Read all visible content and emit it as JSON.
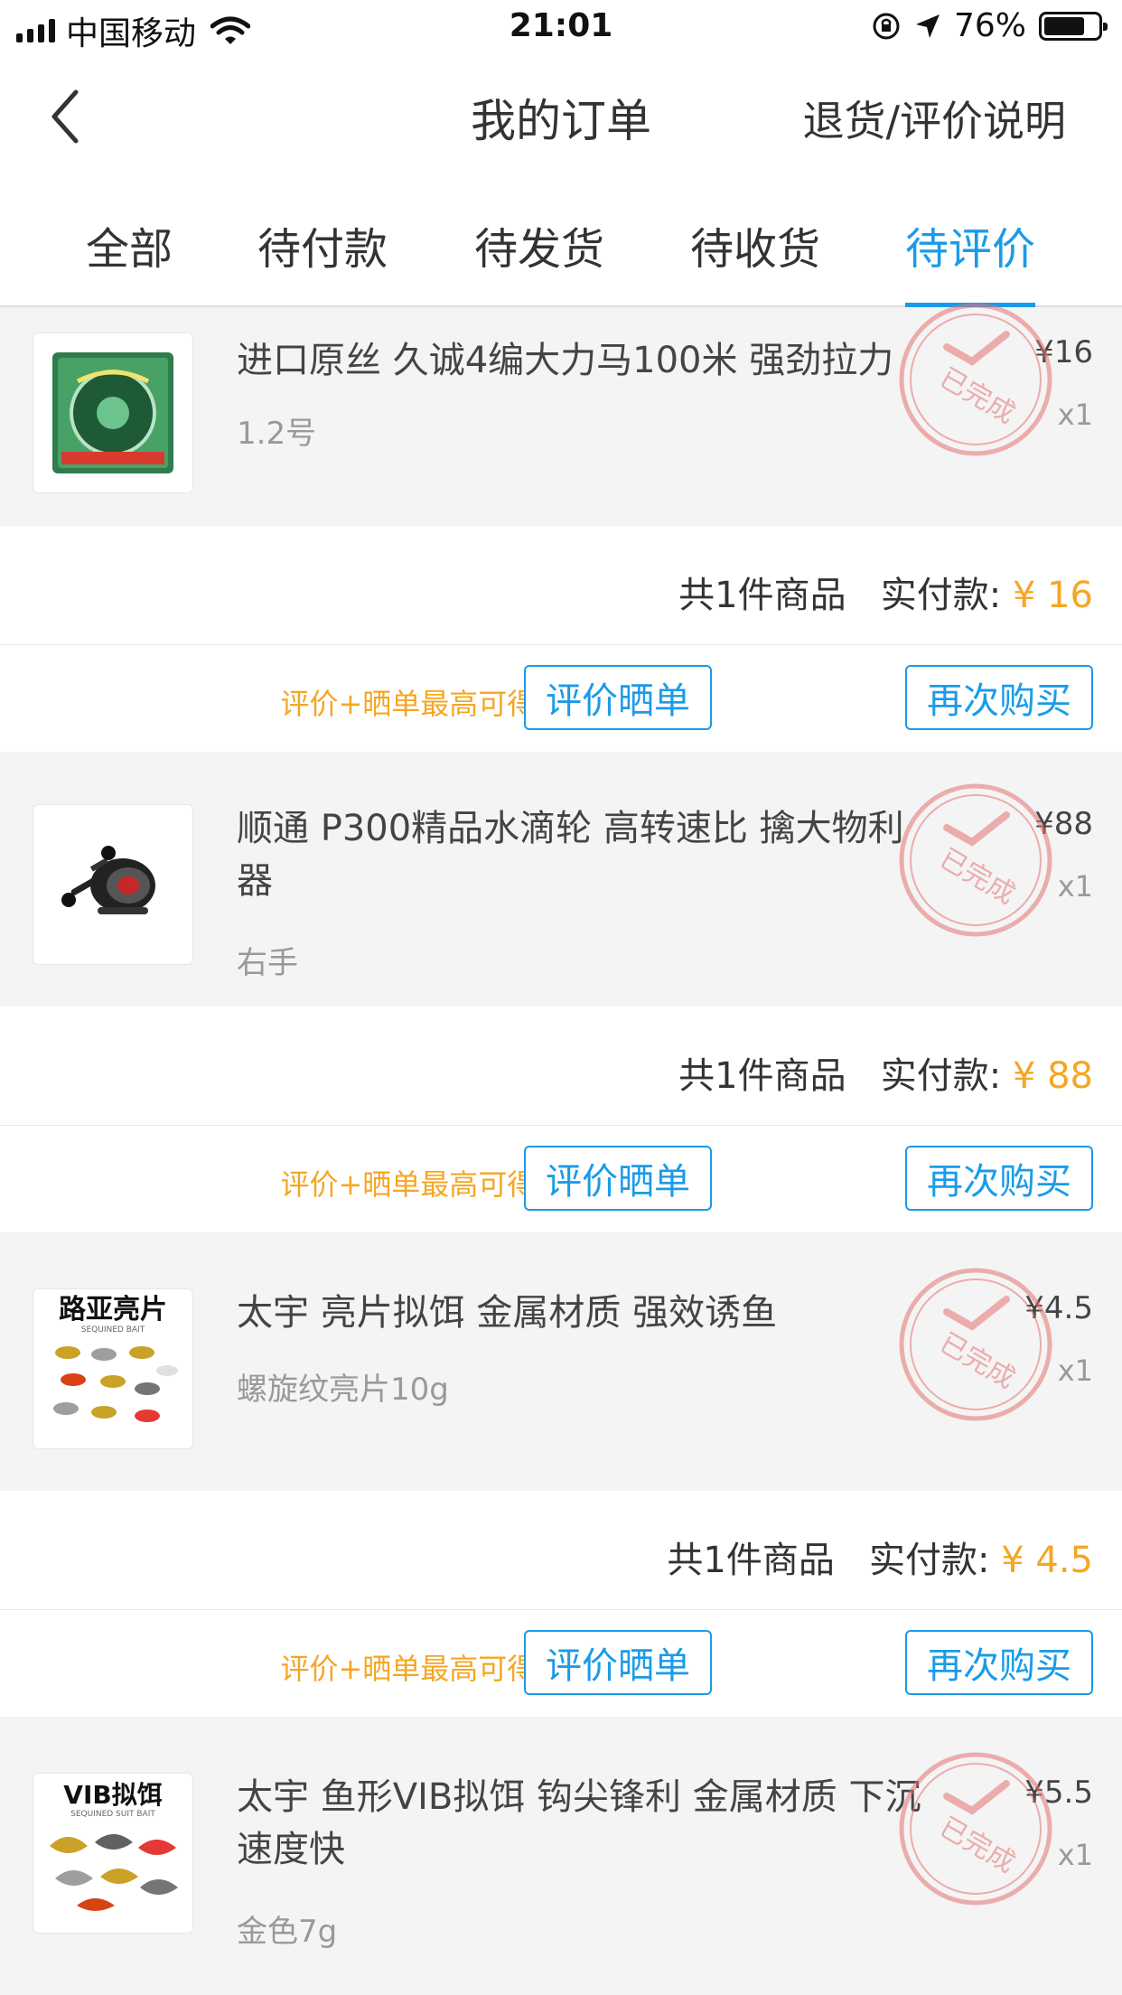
{
  "status_bar": {
    "carrier": "中国移动",
    "time": "21:01",
    "battery": "76%",
    "battery_level": 0.76
  },
  "nav": {
    "title": "我的订单",
    "right_link": "退货/评价说明"
  },
  "tabs": [
    {
      "label": "全部"
    },
    {
      "label": "待付款"
    },
    {
      "label": "待发货"
    },
    {
      "label": "待收货"
    },
    {
      "label": "待评价",
      "active": true
    }
  ],
  "stamp_text": "已完成",
  "orders": [
    {
      "title": "进口原丝 久诚4编大力马100米 强劲拉力",
      "spec": "1.2号",
      "price": "¥16",
      "qty": "x1",
      "summary_count": "共1件商品",
      "summary_label": "实付款:",
      "summary_amount": "¥ 16",
      "promo": "评价+晒单最高可得10元现金",
      "review_btn": "评价晒单",
      "rebuy_btn": "再次购买"
    },
    {
      "title": "顺通 P300精品水滴轮 高转速比 擒大物利器",
      "spec": "右手",
      "price": "¥88",
      "qty": "x1",
      "summary_count": "共1件商品",
      "summary_label": "实付款:",
      "summary_amount": "¥ 88",
      "promo": "评价+晒单最高可得10元现金",
      "review_btn": "评价晒单",
      "rebuy_btn": "再次购买"
    },
    {
      "title": "太宇 亮片拟饵 金属材质 强效诱鱼",
      "spec": "螺旋纹亮片10g",
      "price": "¥4.5",
      "qty": "x1",
      "thumb_text": "路亚亮片",
      "thumb_sub": "SEQUINED BAIT",
      "summary_count": "共1件商品",
      "summary_label": "实付款:",
      "summary_amount": "¥ 4.5",
      "promo": "评价+晒单最高可得10元现金",
      "review_btn": "评价晒单",
      "rebuy_btn": "再次购买"
    },
    {
      "title": "太宇 鱼形VIB拟饵 钩尖锋利 金属材质 下沉速度快",
      "spec": "金色7g",
      "price": "¥5.5",
      "qty": "x1",
      "thumb_text": "VIB拟饵",
      "thumb_sub": "SEQUINED SUIT BAIT"
    }
  ]
}
